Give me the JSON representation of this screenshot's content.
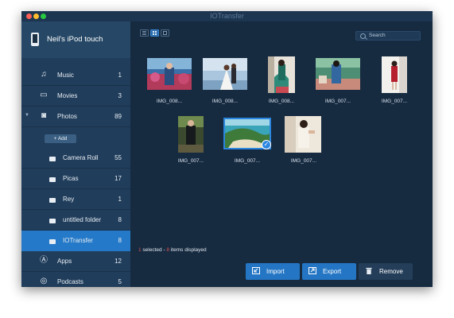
{
  "window": {
    "title": "IOTransfer"
  },
  "sidebar": {
    "device_name": "Neil's iPod touch",
    "items": [
      {
        "label": "Music",
        "count": "1",
        "icon": "music-icon"
      },
      {
        "label": "Movies",
        "count": "3",
        "icon": "movie-icon"
      },
      {
        "label": "Photos",
        "count": "89",
        "icon": "camera-icon"
      },
      {
        "label": "Apps",
        "count": "12",
        "icon": "apps-icon"
      },
      {
        "label": "Podcasts",
        "count": "5",
        "icon": "podcast-icon"
      }
    ],
    "add_label": "+ Add",
    "folders": [
      {
        "label": "Camera Roll",
        "count": "55"
      },
      {
        "label": "Picas",
        "count": "17"
      },
      {
        "label": "Rey",
        "count": "1"
      },
      {
        "label": "untitled folder",
        "count": "8"
      },
      {
        "label": "IOTransfer",
        "count": "8"
      }
    ],
    "active_folder": "IOTransfer"
  },
  "toolbar": {
    "search_placeholder": "Search",
    "active_view": "grid"
  },
  "photos": [
    {
      "name": "IMG_008...",
      "selected": false
    },
    {
      "name": "IMG_008...",
      "selected": false
    },
    {
      "name": "IMG_008...",
      "selected": false
    },
    {
      "name": "IMG_007...",
      "selected": false
    },
    {
      "name": "IMG_007...",
      "selected": false
    },
    {
      "name": "IMG_007...",
      "selected": false
    },
    {
      "name": "IMG_007...",
      "selected": true
    },
    {
      "name": "IMG_007...",
      "selected": false
    }
  ],
  "status": {
    "selected_count": "1",
    "selected_text": " selected - ",
    "displayed_count": "8",
    "displayed_text": " items displayed"
  },
  "actions": {
    "import_label": "Import",
    "export_label": "Export",
    "remove_label": "Remove"
  },
  "colors": {
    "accent": "#2479c8",
    "sidebar_bg": "#203d5b",
    "content_bg": "#162a40",
    "status_red": "#e2504e"
  }
}
